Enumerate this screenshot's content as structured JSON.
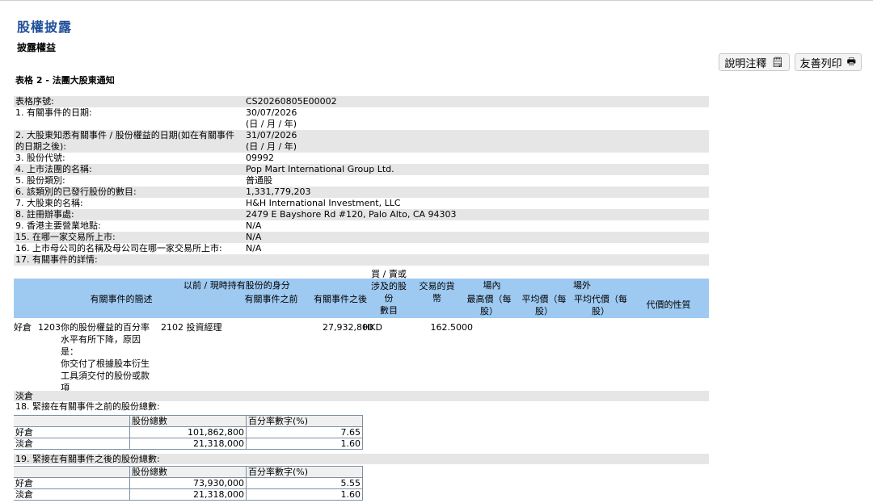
{
  "header": {
    "title": "股權披露",
    "subtitle": "披露權益",
    "form_title": "表格 2 - 法團大股東通知",
    "notes_btn": "說明注釋",
    "print_btn": "友善列印"
  },
  "info_rows": [
    {
      "label": "表格序號:",
      "value": "CS20260805E00002"
    },
    {
      "label": "1. 有關事件的日期:",
      "value": "30/07/2026",
      "value2": "(日 / 月 / 年)"
    },
    {
      "label": "2. 大股東知悉有關事件 / 股份權益的日期(如在有關事件",
      "label2": "的日期之後):",
      "value": "31/07/2026",
      "value2": "(日 / 月 / 年)"
    },
    {
      "label": "3. 股份代號:",
      "value": "09992"
    },
    {
      "label": "4. 上市法團的名稱:",
      "value": "Pop Mart International Group Ltd."
    },
    {
      "label": "5. 股份類別:",
      "value": "普通股"
    },
    {
      "label": "6. 該類別的已發行股份的數目:",
      "value": "1,331,779,203"
    },
    {
      "label": "7. 大股東的名稱:",
      "value": "H&H International Investment, LLC"
    },
    {
      "label": "8. 註冊辦事處:",
      "value": "2479 E Bayshore Rd #120, Palo Alto, CA 94303"
    },
    {
      "label": "9. 香港主要營業地點:",
      "value": "N/A"
    },
    {
      "label": "15. 在哪一家交易所上市:",
      "value": "N/A"
    },
    {
      "label": "16. 上市母公司的名稱及母公司在哪一家交易所上市:",
      "value": "N/A"
    },
    {
      "label": "17. 有關事件的詳情:",
      "value": ""
    }
  ],
  "event_table": {
    "h_event_desc": "有關事件的簡述",
    "h_capacity": "以前 / 現時持有股份的身分",
    "h_before": "有關事件之前",
    "h_after": "有關事件之後",
    "h_shares1": "買 / 賣或涉及的股份",
    "h_shares2": "數目",
    "h_currency1": "交易的貨",
    "h_currency2": "幣",
    "h_onex": "場內",
    "h_offex": "場外",
    "h_high1": "最高價（每",
    "h_high2": "股）",
    "h_avg1": "平均價（每",
    "h_avg2": "股）",
    "h_avgc1": "平均代價（每",
    "h_avgc2": "股）",
    "h_nature": "代價的性質",
    "row": {
      "position": "好倉",
      "code": "1203",
      "desc": [
        "你的股份權益的百分率",
        "水平有所下降，原因",
        "是：",
        "你交付了根據股本衍生",
        "工具須交付的股份或款",
        "項"
      ],
      "capacity": "2102 投資經理",
      "shares": "27,932,800",
      "currency": "HKD",
      "high": "162.5000"
    },
    "short_label": "淡倉"
  },
  "sec18": {
    "title": "18. 緊接在有關事件之前的股份總數:",
    "col_shares": "股份總數",
    "col_pct": "百分率數字(%)",
    "rows": [
      {
        "label": "好倉",
        "shares": "101,862,800",
        "pct": "7.65"
      },
      {
        "label": "淡倉",
        "shares": "21,318,000",
        "pct": "1.60"
      }
    ]
  },
  "sec19": {
    "title": "19. 緊接在有關事件之後的股份總數:",
    "col_shares": "股份總數",
    "col_pct": "百分率數字(%)",
    "rows": [
      {
        "label": "好倉",
        "shares": "73,930,000",
        "pct": "5.55"
      },
      {
        "label": "淡倉",
        "shares": "21,318,000",
        "pct": "1.60"
      }
    ]
  }
}
